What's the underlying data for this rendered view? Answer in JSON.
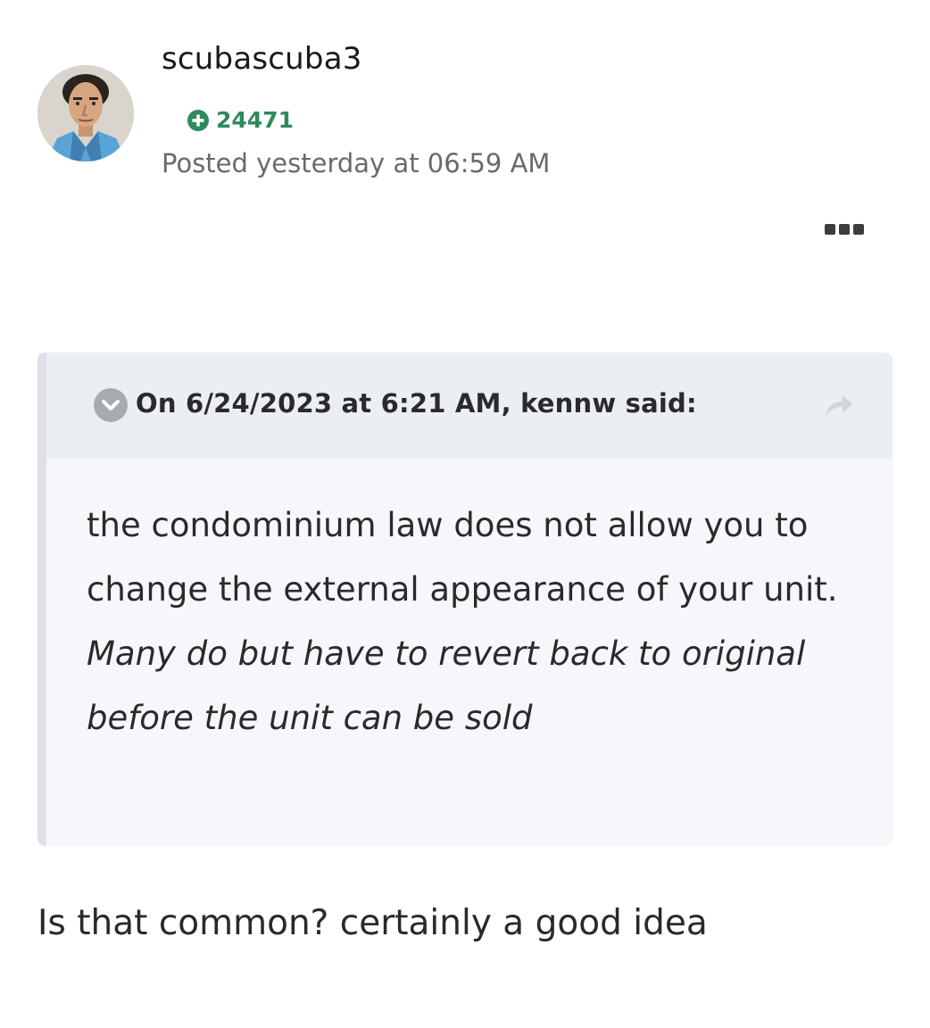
{
  "post": {
    "author": {
      "username": "scubascuba3",
      "reputation": "24471",
      "avatar_icon": "avatar-portrait"
    },
    "posted_text": "Posted yesterday at 06:59 AM",
    "menu_icon": "more-options-icon",
    "quote": {
      "citation": "On 6/24/2023 at 6:21 AM, kennw said:",
      "toggle_icon": "chevron-down-icon",
      "share_icon": "share-arrow-icon",
      "body_normal": "the condominium law does not allow you to change the external appearance of your unit. ",
      "body_italic": "Many do but have to revert back to original before the unit can be sold"
    },
    "reply": "Is that common? certainly a good idea"
  },
  "colors": {
    "reputation": "#2f8a5c",
    "quote_bg": "#f5f7fa",
    "quote_header_bg": "#ebeef2",
    "quote_border": "#dde1e6"
  }
}
